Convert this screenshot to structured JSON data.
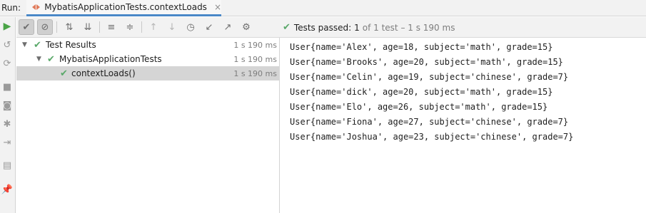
{
  "header": {
    "run_label": "Run:",
    "tab_title": "MybatisApplicationTests.contextLoads",
    "tab_close": "×"
  },
  "toolbar": {
    "status_passed": "Tests passed:",
    "status_count": "1",
    "status_detail": "of 1 test – 1 s 190 ms"
  },
  "tree": {
    "rows": [
      {
        "label": "Test Results",
        "time": "1 s 190 ms"
      },
      {
        "label": "MybatisApplicationTests",
        "time": "1 s 190 ms"
      },
      {
        "label": "contextLoads()",
        "time": "1 s 190 ms"
      }
    ]
  },
  "console": {
    "lines": [
      "User{name='Alex', age=18, subject='math', grade=15}",
      "User{name='Brooks', age=20, subject='math', grade=15}",
      "User{name='Celin', age=19, subject='chinese', grade=7}",
      "User{name='dick', age=20, subject='math', grade=15}",
      "User{name='Elo', age=26, subject='math', grade=15}",
      "User{name='Fiona', age=27, subject='chinese', grade=7}",
      "User{name='Joshua', age=23, subject='chinese', grade=7}"
    ]
  },
  "icons": {
    "run": "play-icon",
    "rerun_failed": "rerun-icon",
    "toggle_auto": "toggle-auto-test-icon",
    "stop": "stop-icon",
    "camera": "camera-icon",
    "pin": "pin-icon"
  },
  "colors": {
    "success": "#59a869",
    "tab_underline": "#4a88c7",
    "selection": "#d5d5d5"
  }
}
